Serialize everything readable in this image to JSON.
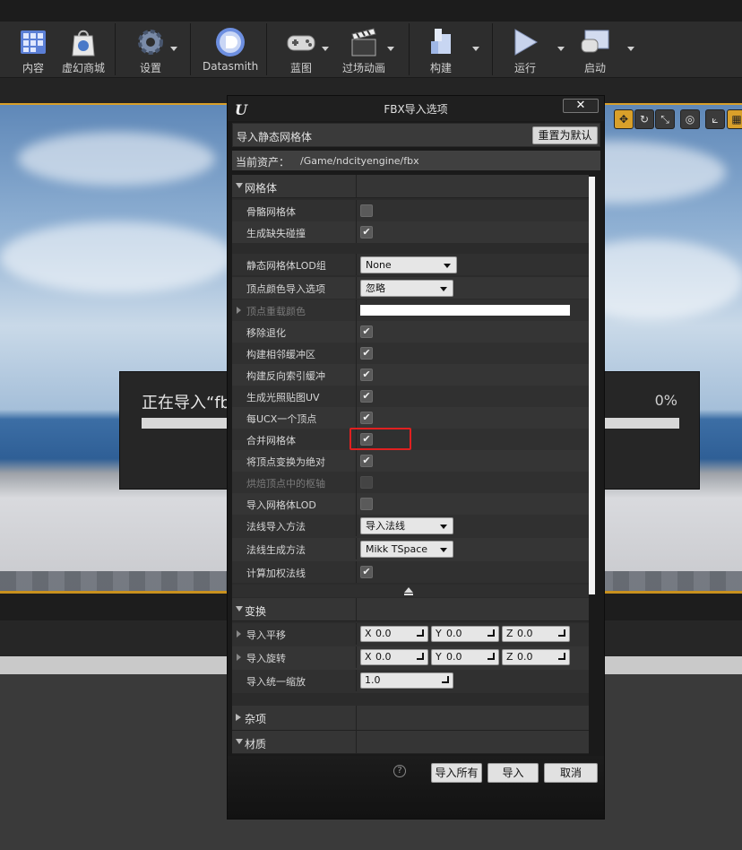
{
  "toolbar": {
    "items": [
      {
        "label": "内容",
        "icon": "content-browser-icon"
      },
      {
        "label": "虚幻商城",
        "icon": "marketplace-icon"
      },
      {
        "label": "设置",
        "icon": "settings-gear-icon"
      },
      {
        "label": "Datasmith",
        "icon": "datasmith-icon"
      },
      {
        "label": "蓝图",
        "icon": "blueprint-gamepad-icon"
      },
      {
        "label": "过场动画",
        "icon": "cinematics-clapper-icon"
      },
      {
        "label": "构建",
        "icon": "build-blocks-icon"
      },
      {
        "label": "运行",
        "icon": "play-icon"
      },
      {
        "label": "启动",
        "icon": "launch-icon"
      }
    ]
  },
  "progress": {
    "text": "正在导入“fb",
    "percent": "0%",
    "value": 0
  },
  "dialog": {
    "title": "FBX导入选项",
    "close": "✕",
    "header_label": "导入静态网格体",
    "reset_label": "重置为默认",
    "asset_label": "当前资产：",
    "asset_path": "/Game/ndcityengine/fbx",
    "categories": {
      "mesh": "网格体",
      "transform": "变换",
      "misc": "杂项",
      "material": "材质"
    },
    "mesh_rows": {
      "skeletal": "骨骼网格体",
      "gen_collision": "生成缺失碰撞",
      "lod_group": "静态网格体LOD组",
      "lod_group_value": "None",
      "vertex_color": "顶点颜色导入选项",
      "vertex_color_value": "忽略",
      "vertex_override": "顶点重载颜色",
      "remove_degen": "移除退化",
      "adjacency": "构建相邻缓冲区",
      "reverse_index": "构建反向索引缓冲",
      "lightmap_uv": "生成光照贴图UV",
      "one_convex": "每UCX一个顶点",
      "combine": "合并网格体",
      "transform_abs": "将顶点变换为绝对",
      "bake_pivot": "烘焙顶点中的枢轴",
      "import_lod": "导入网格体LOD",
      "normal_import": "法线导入方法",
      "normal_import_value": "导入法线",
      "normal_gen": "法线生成方法",
      "normal_gen_value": "Mikk TSpace",
      "weighted_normals": "计算加权法线"
    },
    "checks": {
      "skeletal": false,
      "gen_collision": true,
      "remove_degen": true,
      "adjacency": true,
      "reverse_index": true,
      "lightmap_uv": true,
      "one_convex": true,
      "combine": true,
      "transform_abs": true,
      "bake_pivot": false,
      "import_lod": false,
      "weighted_normals": true
    },
    "transform_rows": {
      "translation": "导入平移",
      "rotation": "导入旋转",
      "uniform_scale": "导入统一缩放",
      "x": "X",
      "y": "Y",
      "z": "Z",
      "t_x": "0.0",
      "t_y": "0.0",
      "t_z": "0.0",
      "r_x": "0.0",
      "r_y": "0.0",
      "r_z": "0.0",
      "scale": "1.0"
    },
    "footer": {
      "help": "?",
      "import_all": "导入所有",
      "import": "导入",
      "cancel": "取消"
    }
  },
  "colors": {
    "highlight": "#e02020",
    "viewport_border": "#d9a02a"
  }
}
